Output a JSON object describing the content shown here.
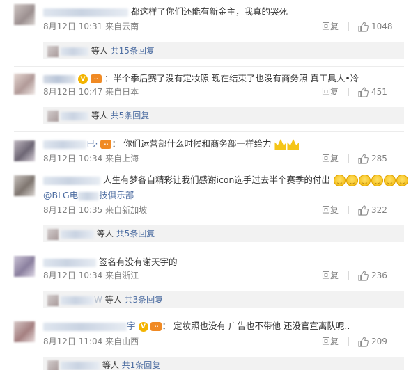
{
  "comments": [
    {
      "text": "都这样了你们还能有新金主，我真的哭死",
      "date": "8月12日 10:31",
      "location": "来自云南",
      "reply_label": "回复",
      "likes": "1048",
      "sub": {
        "people_label": "等人",
        "count_label": "共15条回复"
      }
    },
    {
      "colon": "：",
      "text": "半个季后赛了没有定妆照 现在结束了也没有商务照 真工具人•冷",
      "date": "8月12日 10:47",
      "location": "来自日本",
      "reply_label": "回复",
      "likes": "451",
      "sub": {
        "people_label": "等人",
        "count_label": "共5条回复"
      }
    },
    {
      "name_tail": "已·",
      "colon": "：",
      "text": "你们运营部什么时候和商务部一样给力",
      "date": "8月12日 10:34",
      "location": "来自上海",
      "reply_label": "回复",
      "likes": "285"
    },
    {
      "text": "人生有梦各自精彩让我们感谢icon选手过去半个赛季的付出",
      "mention_prefix": "@BLG电",
      "mention_suffix": "技俱乐部",
      "date": "8月12日 10:35",
      "location": "来自新加坡",
      "reply_label": "回复",
      "likes": "322",
      "sub": {
        "people_label": "等人",
        "count_label": "共5条回复"
      }
    },
    {
      "text": "签名有没有谢天宇的",
      "date": "8月12日 10:34",
      "location": "来自浙江",
      "reply_label": "回复",
      "likes": "236",
      "sub": {
        "name_tail": "W",
        "people_label": "等人",
        "count_label": "共3条回复"
      }
    },
    {
      "name_tail": "宇",
      "colon": "：",
      "text": "定妆照也没有 广告也不带他 还没官宣离队呢..",
      "date": "8月12日 11:04",
      "location": "来自山西",
      "reply_label": "回复",
      "likes": "209",
      "sub": {
        "people_label": "等人",
        "count_label": "共1条回复"
      }
    }
  ],
  "badges": {
    "verified": "V",
    "level": "··"
  },
  "icons": {
    "like": "thumbs-up-icon",
    "emoji": "smile-emoji-icon",
    "crown": "crown-emoji-icon"
  },
  "colors": {
    "link": "#4e6ea2",
    "meta": "#808080",
    "reply_box": "#f2f2f2"
  }
}
